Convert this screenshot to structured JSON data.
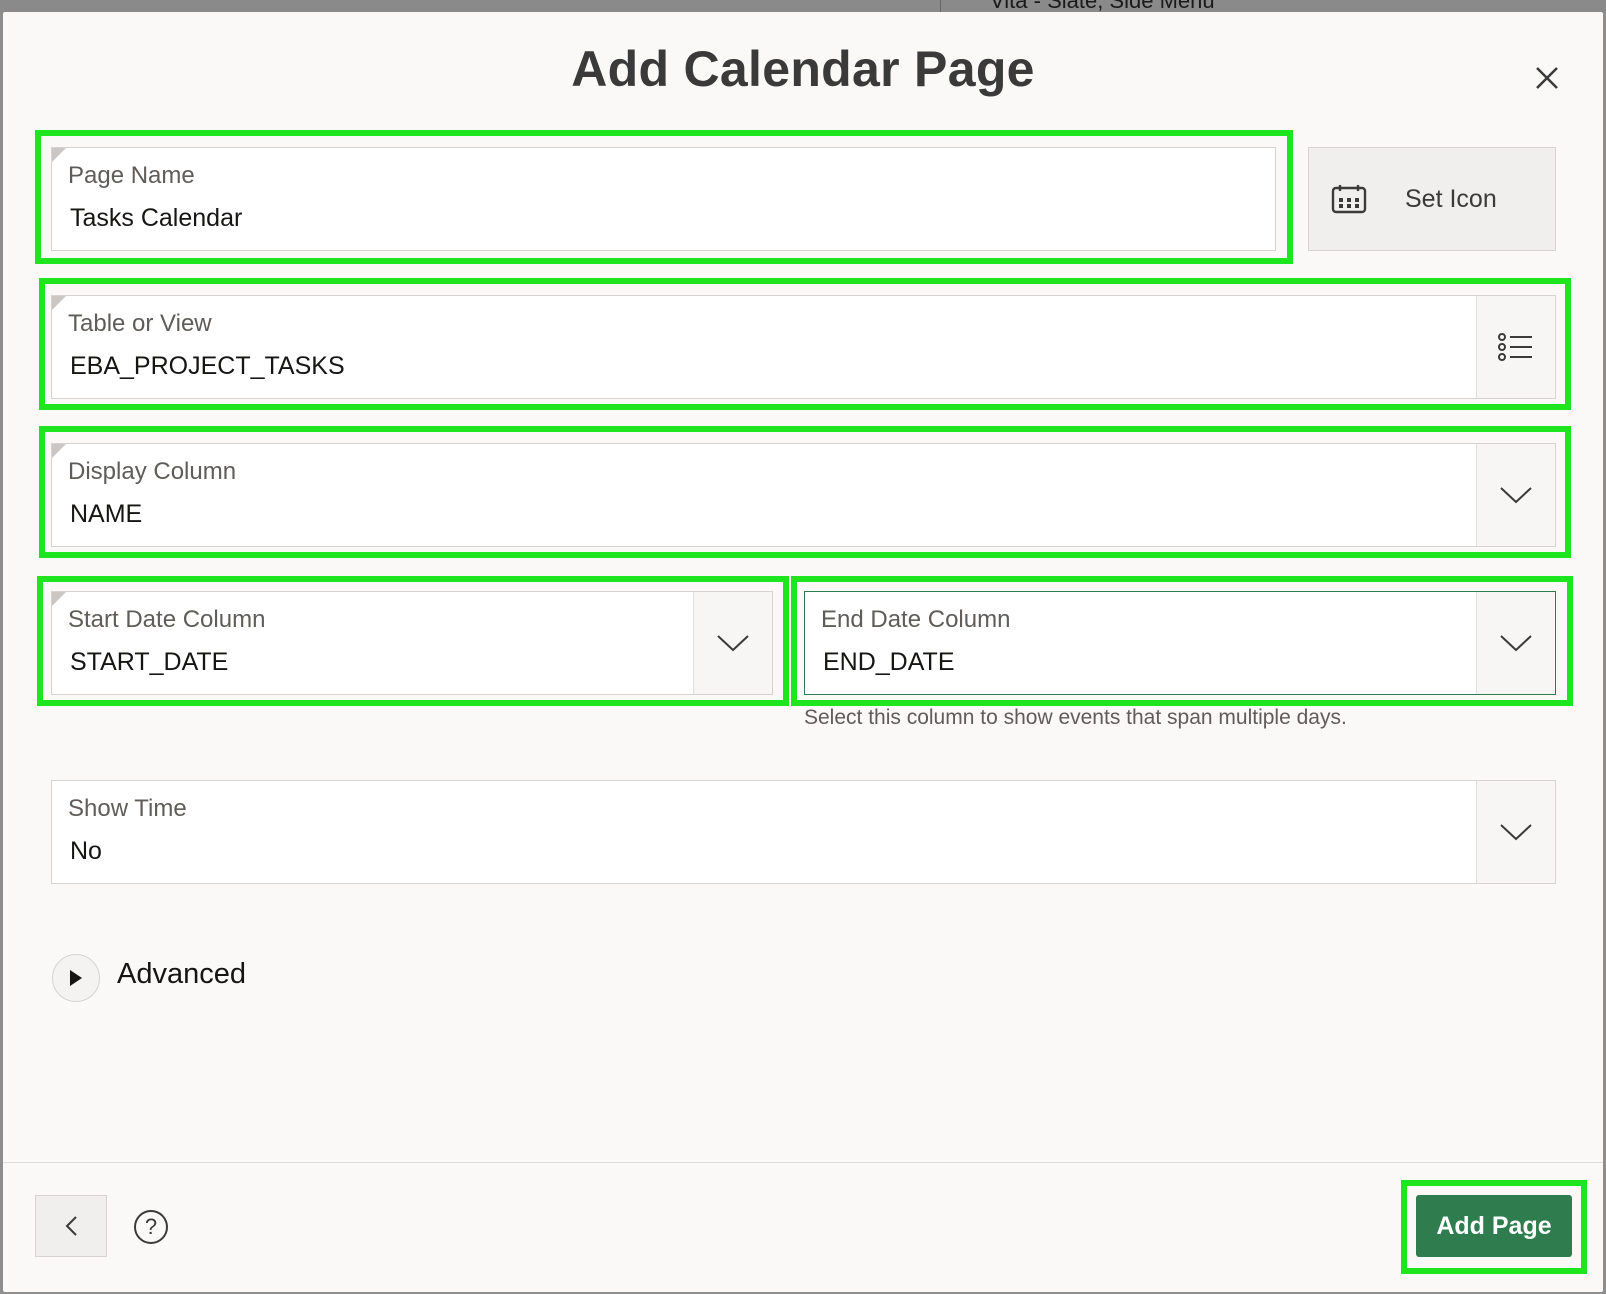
{
  "background": {
    "partial_text": "Vita - Slate, Side Menu"
  },
  "dialog": {
    "title": "Add Calendar Page"
  },
  "fields": {
    "page_name": {
      "label": "Page Name",
      "value": "Tasks Calendar"
    },
    "table_or_view": {
      "label": "Table or View",
      "value": "EBA_PROJECT_TASKS"
    },
    "display_column": {
      "label": "Display Column",
      "value": "NAME"
    },
    "start_date_column": {
      "label": "Start Date Column",
      "value": "START_DATE"
    },
    "end_date_column": {
      "label": "End Date Column",
      "value": "END_DATE",
      "help": "Select this column to show events that span multiple days."
    },
    "show_time": {
      "label": "Show Time",
      "value": "No"
    }
  },
  "set_icon": {
    "label": "Set Icon"
  },
  "advanced": {
    "label": "Advanced"
  },
  "footer": {
    "help_glyph": "?",
    "add_page_label": "Add Page"
  },
  "colors": {
    "primary": "#2f7d4e",
    "highlight": "#1ee61e",
    "focus_border": "#2e7d4f"
  }
}
